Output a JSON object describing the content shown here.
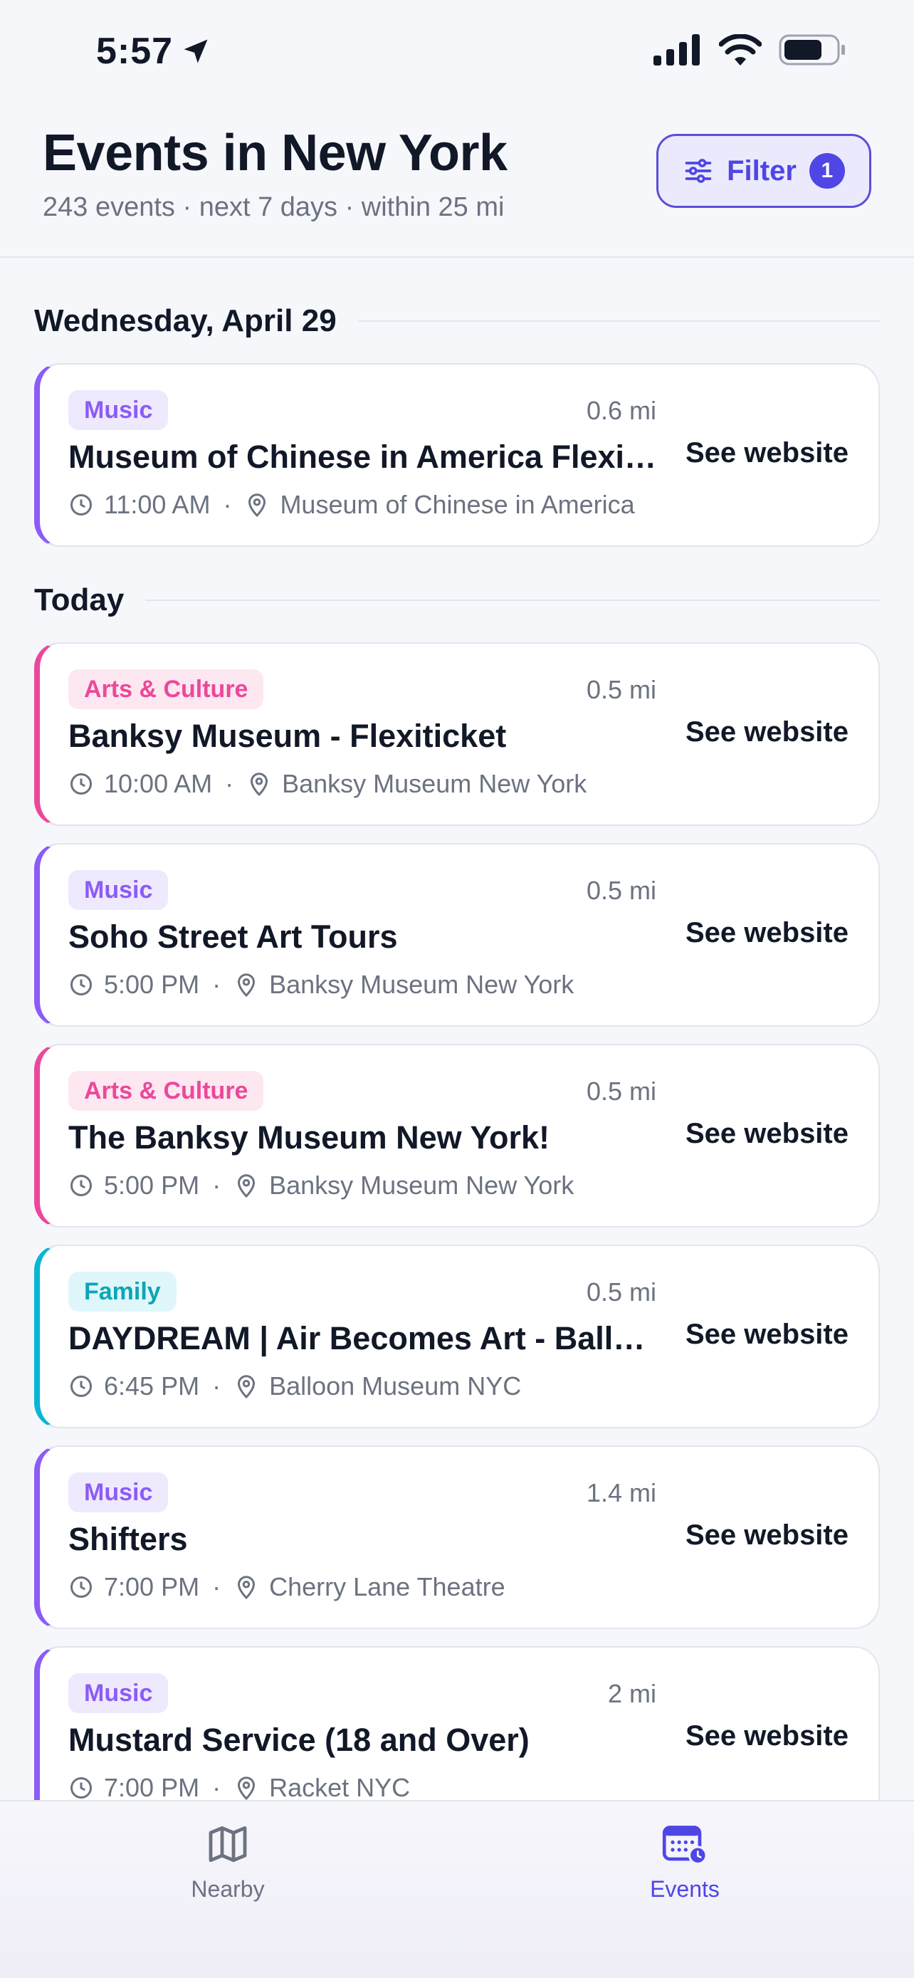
{
  "status_bar": {
    "time": "5:57"
  },
  "header": {
    "title": "Events in New York",
    "subtitle": "243 events · next 7 days · within 25 mi",
    "filter_label": "Filter",
    "filter_count": "1"
  },
  "sections": [
    {
      "title": "Wednesday, April 29"
    },
    {
      "title": "Today"
    }
  ],
  "events": [
    {
      "category": "Music",
      "distance": "0.6 mi",
      "title": "Museum of Chinese in America Flexiticket",
      "time": "11:00 AM",
      "venue": "Museum of Chinese in America",
      "action": "See website"
    },
    {
      "category": "Arts & Culture",
      "distance": "0.5 mi",
      "title": "Banksy Museum - Flexiticket",
      "time": "10:00 AM",
      "venue": "Banksy Museum New York",
      "action": "See website"
    },
    {
      "category": "Music",
      "distance": "0.5 mi",
      "title": "Soho Street Art Tours",
      "time": "5:00 PM",
      "venue": "Banksy Museum New York",
      "action": "See website"
    },
    {
      "category": "Arts & Culture",
      "distance": "0.5 mi",
      "title": "The Banksy Museum New York!",
      "time": "5:00 PM",
      "venue": "Banksy Museum New York",
      "action": "See website"
    },
    {
      "category": "Family",
      "distance": "0.5 mi",
      "title": "DAYDREAM | Air Becomes Art - Balloon Museum",
      "time": "6:45 PM",
      "venue": "Balloon Museum NYC",
      "action": "See website"
    },
    {
      "category": "Music",
      "distance": "1.4 mi",
      "title": "Shifters",
      "time": "7:00 PM",
      "venue": "Cherry Lane Theatre",
      "action": "See website"
    },
    {
      "category": "Music",
      "distance": "2 mi",
      "title": "Mustard Service (18 and Over)",
      "time": "7:00 PM",
      "venue": "Racket NYC",
      "action": "See website"
    }
  ],
  "tabs": [
    {
      "label": "Nearby",
      "icon": "map-icon",
      "active": false
    },
    {
      "label": "Events",
      "icon": "calendar-icon",
      "active": true
    }
  ],
  "colors": {
    "accent": "#4f46e5",
    "music": "#8b5cf6",
    "arts": "#ec4899",
    "family": "#06b6d4"
  }
}
